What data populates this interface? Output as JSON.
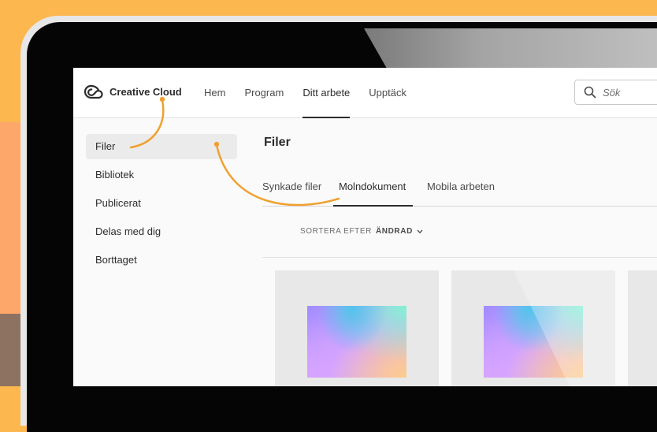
{
  "app": {
    "brand_name": "Creative Cloud",
    "logo_icon": "creative-cloud-logo-icon"
  },
  "nav": {
    "items": [
      {
        "label": "Hem"
      },
      {
        "label": "Program"
      },
      {
        "label": "Ditt arbete",
        "active": true
      },
      {
        "label": "Upptäck"
      }
    ]
  },
  "search": {
    "placeholder": "Sök",
    "icon": "search-icon"
  },
  "sidebar": {
    "items": [
      {
        "label": "Filer",
        "active": true
      },
      {
        "label": "Bibliotek"
      },
      {
        "label": "Publicerat"
      },
      {
        "label": "Delas med dig"
      },
      {
        "label": "Borttaget"
      }
    ]
  },
  "main": {
    "title": "Filer",
    "tabs": [
      {
        "label": "Synkade filer"
      },
      {
        "label": "Molndokument",
        "active": true
      },
      {
        "label": "Mobila arbeten"
      }
    ],
    "sort": {
      "label": "SORTERA EFTER",
      "value": "ÄNDRAD",
      "icon": "chevron-down-icon"
    },
    "cards": [
      {
        "thumbnail": "gradient-document-thumbnail"
      },
      {
        "thumbnail": "gradient-document-thumbnail"
      }
    ]
  },
  "colors": {
    "background": "#fdb74f",
    "annotation": "#f0a030",
    "device_bezel": "#050505",
    "screen_bg": "#fafafa",
    "active_underline": "#2c2c2c"
  }
}
